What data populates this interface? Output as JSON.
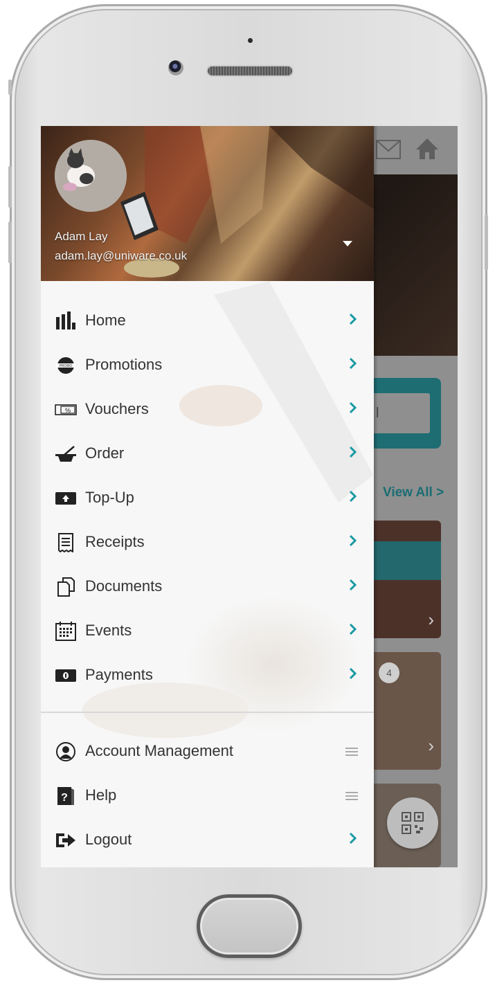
{
  "user": {
    "name": "Adam Lay",
    "email": "adam.lay@uniware.co.uk"
  },
  "menu": [
    {
      "label": "Home",
      "icon": "bar-chart-icon",
      "action": "chevron"
    },
    {
      "label": "Promotions",
      "icon": "promo-icon",
      "action": "chevron"
    },
    {
      "label": "Vouchers",
      "icon": "voucher-icon",
      "action": "chevron"
    },
    {
      "label": "Order",
      "icon": "order-bowl-icon",
      "action": "chevron"
    },
    {
      "label": "Top-Up",
      "icon": "topup-icon",
      "action": "chevron"
    },
    {
      "label": "Receipts",
      "icon": "receipt-icon",
      "action": "chevron"
    },
    {
      "label": "Documents",
      "icon": "documents-icon",
      "action": "chevron"
    },
    {
      "label": "Events",
      "icon": "calendar-icon",
      "action": "chevron"
    },
    {
      "label": "Payments",
      "icon": "payments-icon",
      "action": "chevron"
    }
  ],
  "footer_menu": [
    {
      "label": "Account Management",
      "icon": "account-icon",
      "action": "drag-handle"
    },
    {
      "label": "Help",
      "icon": "help-icon",
      "action": "drag-handle"
    },
    {
      "label": "Logout",
      "icon": "logout-icon",
      "action": "chevron"
    }
  ],
  "background": {
    "view_all": "View All >",
    "badge_count": "4"
  },
  "colors": {
    "accent": "#1a9aa3",
    "teal_card": "#1e6d73",
    "menu_text": "#333333"
  }
}
